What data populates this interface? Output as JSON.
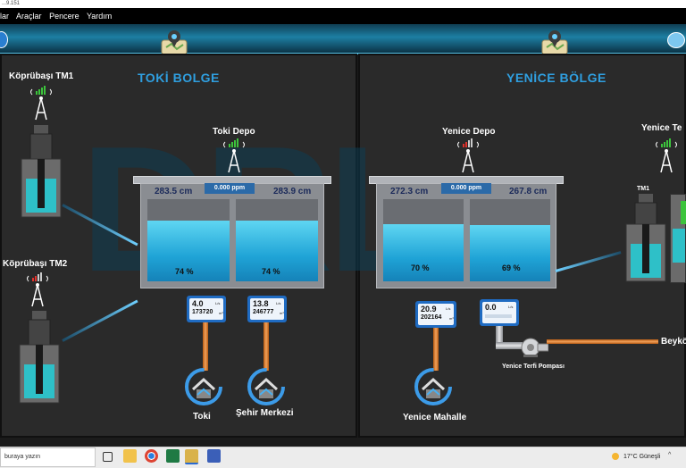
{
  "window": {
    "title": "...9.151"
  },
  "menu": {
    "items": [
      "lar",
      "Araçlar",
      "Pencere",
      "Yardım"
    ]
  },
  "watermark": "DRL",
  "left_region": {
    "title": "TOKİ BOLGE",
    "stations": [
      {
        "label": "Köprübaşı TM1"
      },
      {
        "label": "Köprübaşı TM2"
      }
    ],
    "depot": {
      "label": "Toki Depo",
      "ppm": "0.000 ppm",
      "left_level": "283.5 cm",
      "right_level": "283.9 cm",
      "left_pct": "74 %",
      "right_pct": "74 %",
      "left_fill": 0.74,
      "right_fill": 0.74
    },
    "meters": [
      {
        "flow": "4.0",
        "unit": "L/s",
        "total": "173720",
        "total_unit": "m³"
      },
      {
        "flow": "13.8",
        "unit": "L/s",
        "total": "246777",
        "total_unit": "m³"
      }
    ],
    "destinations": [
      {
        "label": "Toki"
      },
      {
        "label": "Şehir Merkezi"
      }
    ]
  },
  "right_region": {
    "title": "YENİCE BÖLGE",
    "depot": {
      "label": "Yenice Depo",
      "ppm": "0.000 ppm",
      "left_level": "272.3 cm",
      "right_level": "267.8 cm",
      "left_pct": "70 %",
      "right_pct": "69 %",
      "left_fill": 0.7,
      "right_fill": 0.69
    },
    "station": {
      "label": "Yenice Te",
      "sub_label": "TM1"
    },
    "meters": [
      {
        "flow": "20.9",
        "unit": "L/s",
        "total": "202164",
        "total_unit": "m³"
      },
      {
        "flow": "0.0",
        "unit": "L/s",
        "total": "",
        "total_unit": ""
      }
    ],
    "pump": {
      "label": "Yenice Terfi Pompası"
    },
    "destinations": [
      {
        "label": "Yenice Mahalle"
      },
      {
        "label": "Beykö"
      }
    ]
  },
  "taskbar": {
    "search_placeholder": "buraya yazın",
    "weather": "17°C Güneşli"
  },
  "colors": {
    "accent_blue": "#2f9fe0",
    "signal_green": "#3cc43c",
    "signal_red": "#e0312b",
    "water": "#1fa3d6",
    "pipe": "#e08a3a"
  }
}
